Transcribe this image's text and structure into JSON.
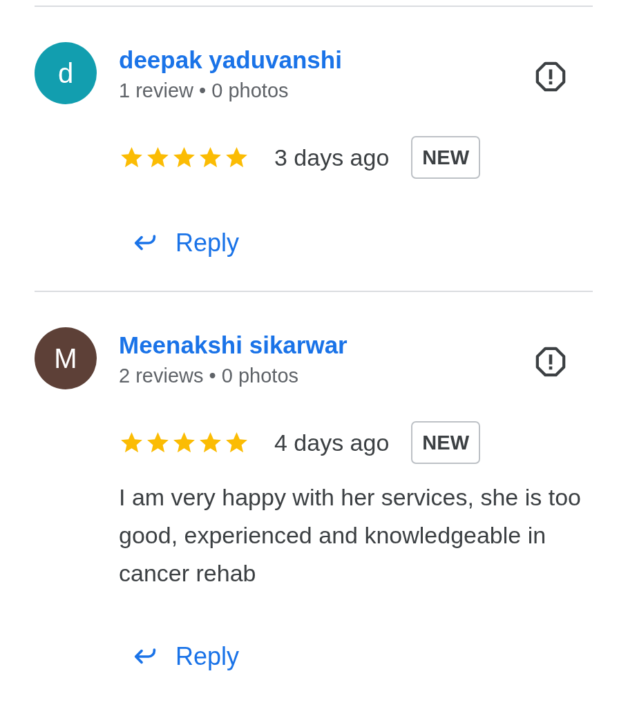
{
  "reviews": [
    {
      "avatar_letter": "d",
      "color": "#129eaf",
      "name": "deepak yaduvanshi",
      "meta": "1 review • 0 photos",
      "stars": 5,
      "time": "3 days ago",
      "badge": "NEW",
      "reply": "Reply"
    },
    {
      "avatar_letter": "M",
      "color": "#5d4037",
      "name": "Meenakshi sikarwar",
      "meta": "2 reviews • 0 photos",
      "stars": 5,
      "time": "4 days ago",
      "badge": "NEW",
      "text": "I am very happy with her services, she is too good, experienced and knowledgeable in cancer rehab",
      "reply": "Reply"
    }
  ]
}
